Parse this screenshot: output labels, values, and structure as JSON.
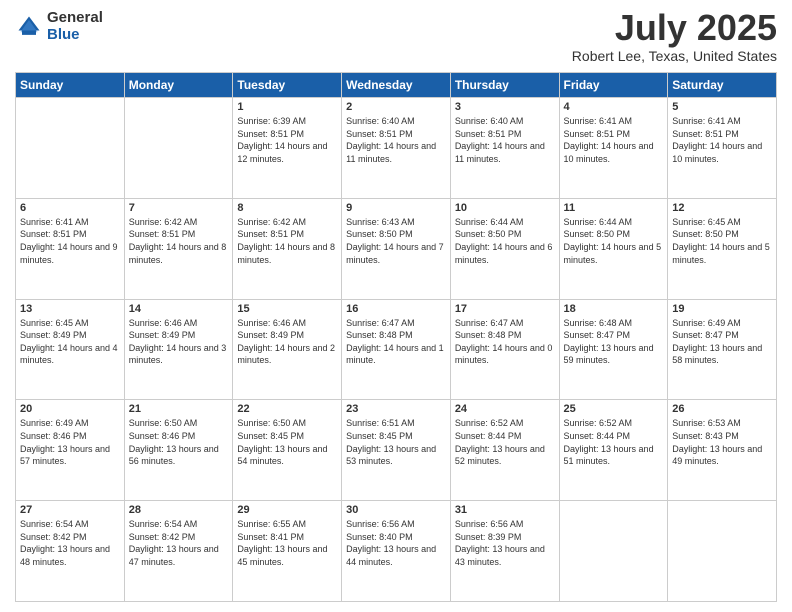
{
  "logo": {
    "general": "General",
    "blue": "Blue"
  },
  "title": "July 2025",
  "subtitle": "Robert Lee, Texas, United States",
  "days_header": [
    "Sunday",
    "Monday",
    "Tuesday",
    "Wednesday",
    "Thursday",
    "Friday",
    "Saturday"
  ],
  "weeks": [
    [
      {
        "day": "",
        "info": ""
      },
      {
        "day": "",
        "info": ""
      },
      {
        "day": "1",
        "info": "Sunrise: 6:39 AM\nSunset: 8:51 PM\nDaylight: 14 hours and 12 minutes."
      },
      {
        "day": "2",
        "info": "Sunrise: 6:40 AM\nSunset: 8:51 PM\nDaylight: 14 hours and 11 minutes."
      },
      {
        "day": "3",
        "info": "Sunrise: 6:40 AM\nSunset: 8:51 PM\nDaylight: 14 hours and 11 minutes."
      },
      {
        "day": "4",
        "info": "Sunrise: 6:41 AM\nSunset: 8:51 PM\nDaylight: 14 hours and 10 minutes."
      },
      {
        "day": "5",
        "info": "Sunrise: 6:41 AM\nSunset: 8:51 PM\nDaylight: 14 hours and 10 minutes."
      }
    ],
    [
      {
        "day": "6",
        "info": "Sunrise: 6:41 AM\nSunset: 8:51 PM\nDaylight: 14 hours and 9 minutes."
      },
      {
        "day": "7",
        "info": "Sunrise: 6:42 AM\nSunset: 8:51 PM\nDaylight: 14 hours and 8 minutes."
      },
      {
        "day": "8",
        "info": "Sunrise: 6:42 AM\nSunset: 8:51 PM\nDaylight: 14 hours and 8 minutes."
      },
      {
        "day": "9",
        "info": "Sunrise: 6:43 AM\nSunset: 8:50 PM\nDaylight: 14 hours and 7 minutes."
      },
      {
        "day": "10",
        "info": "Sunrise: 6:44 AM\nSunset: 8:50 PM\nDaylight: 14 hours and 6 minutes."
      },
      {
        "day": "11",
        "info": "Sunrise: 6:44 AM\nSunset: 8:50 PM\nDaylight: 14 hours and 5 minutes."
      },
      {
        "day": "12",
        "info": "Sunrise: 6:45 AM\nSunset: 8:50 PM\nDaylight: 14 hours and 5 minutes."
      }
    ],
    [
      {
        "day": "13",
        "info": "Sunrise: 6:45 AM\nSunset: 8:49 PM\nDaylight: 14 hours and 4 minutes."
      },
      {
        "day": "14",
        "info": "Sunrise: 6:46 AM\nSunset: 8:49 PM\nDaylight: 14 hours and 3 minutes."
      },
      {
        "day": "15",
        "info": "Sunrise: 6:46 AM\nSunset: 8:49 PM\nDaylight: 14 hours and 2 minutes."
      },
      {
        "day": "16",
        "info": "Sunrise: 6:47 AM\nSunset: 8:48 PM\nDaylight: 14 hours and 1 minute."
      },
      {
        "day": "17",
        "info": "Sunrise: 6:47 AM\nSunset: 8:48 PM\nDaylight: 14 hours and 0 minutes."
      },
      {
        "day": "18",
        "info": "Sunrise: 6:48 AM\nSunset: 8:47 PM\nDaylight: 13 hours and 59 minutes."
      },
      {
        "day": "19",
        "info": "Sunrise: 6:49 AM\nSunset: 8:47 PM\nDaylight: 13 hours and 58 minutes."
      }
    ],
    [
      {
        "day": "20",
        "info": "Sunrise: 6:49 AM\nSunset: 8:46 PM\nDaylight: 13 hours and 57 minutes."
      },
      {
        "day": "21",
        "info": "Sunrise: 6:50 AM\nSunset: 8:46 PM\nDaylight: 13 hours and 56 minutes."
      },
      {
        "day": "22",
        "info": "Sunrise: 6:50 AM\nSunset: 8:45 PM\nDaylight: 13 hours and 54 minutes."
      },
      {
        "day": "23",
        "info": "Sunrise: 6:51 AM\nSunset: 8:45 PM\nDaylight: 13 hours and 53 minutes."
      },
      {
        "day": "24",
        "info": "Sunrise: 6:52 AM\nSunset: 8:44 PM\nDaylight: 13 hours and 52 minutes."
      },
      {
        "day": "25",
        "info": "Sunrise: 6:52 AM\nSunset: 8:44 PM\nDaylight: 13 hours and 51 minutes."
      },
      {
        "day": "26",
        "info": "Sunrise: 6:53 AM\nSunset: 8:43 PM\nDaylight: 13 hours and 49 minutes."
      }
    ],
    [
      {
        "day": "27",
        "info": "Sunrise: 6:54 AM\nSunset: 8:42 PM\nDaylight: 13 hours and 48 minutes."
      },
      {
        "day": "28",
        "info": "Sunrise: 6:54 AM\nSunset: 8:42 PM\nDaylight: 13 hours and 47 minutes."
      },
      {
        "day": "29",
        "info": "Sunrise: 6:55 AM\nSunset: 8:41 PM\nDaylight: 13 hours and 45 minutes."
      },
      {
        "day": "30",
        "info": "Sunrise: 6:56 AM\nSunset: 8:40 PM\nDaylight: 13 hours and 44 minutes."
      },
      {
        "day": "31",
        "info": "Sunrise: 6:56 AM\nSunset: 8:39 PM\nDaylight: 13 hours and 43 minutes."
      },
      {
        "day": "",
        "info": ""
      },
      {
        "day": "",
        "info": ""
      }
    ]
  ]
}
